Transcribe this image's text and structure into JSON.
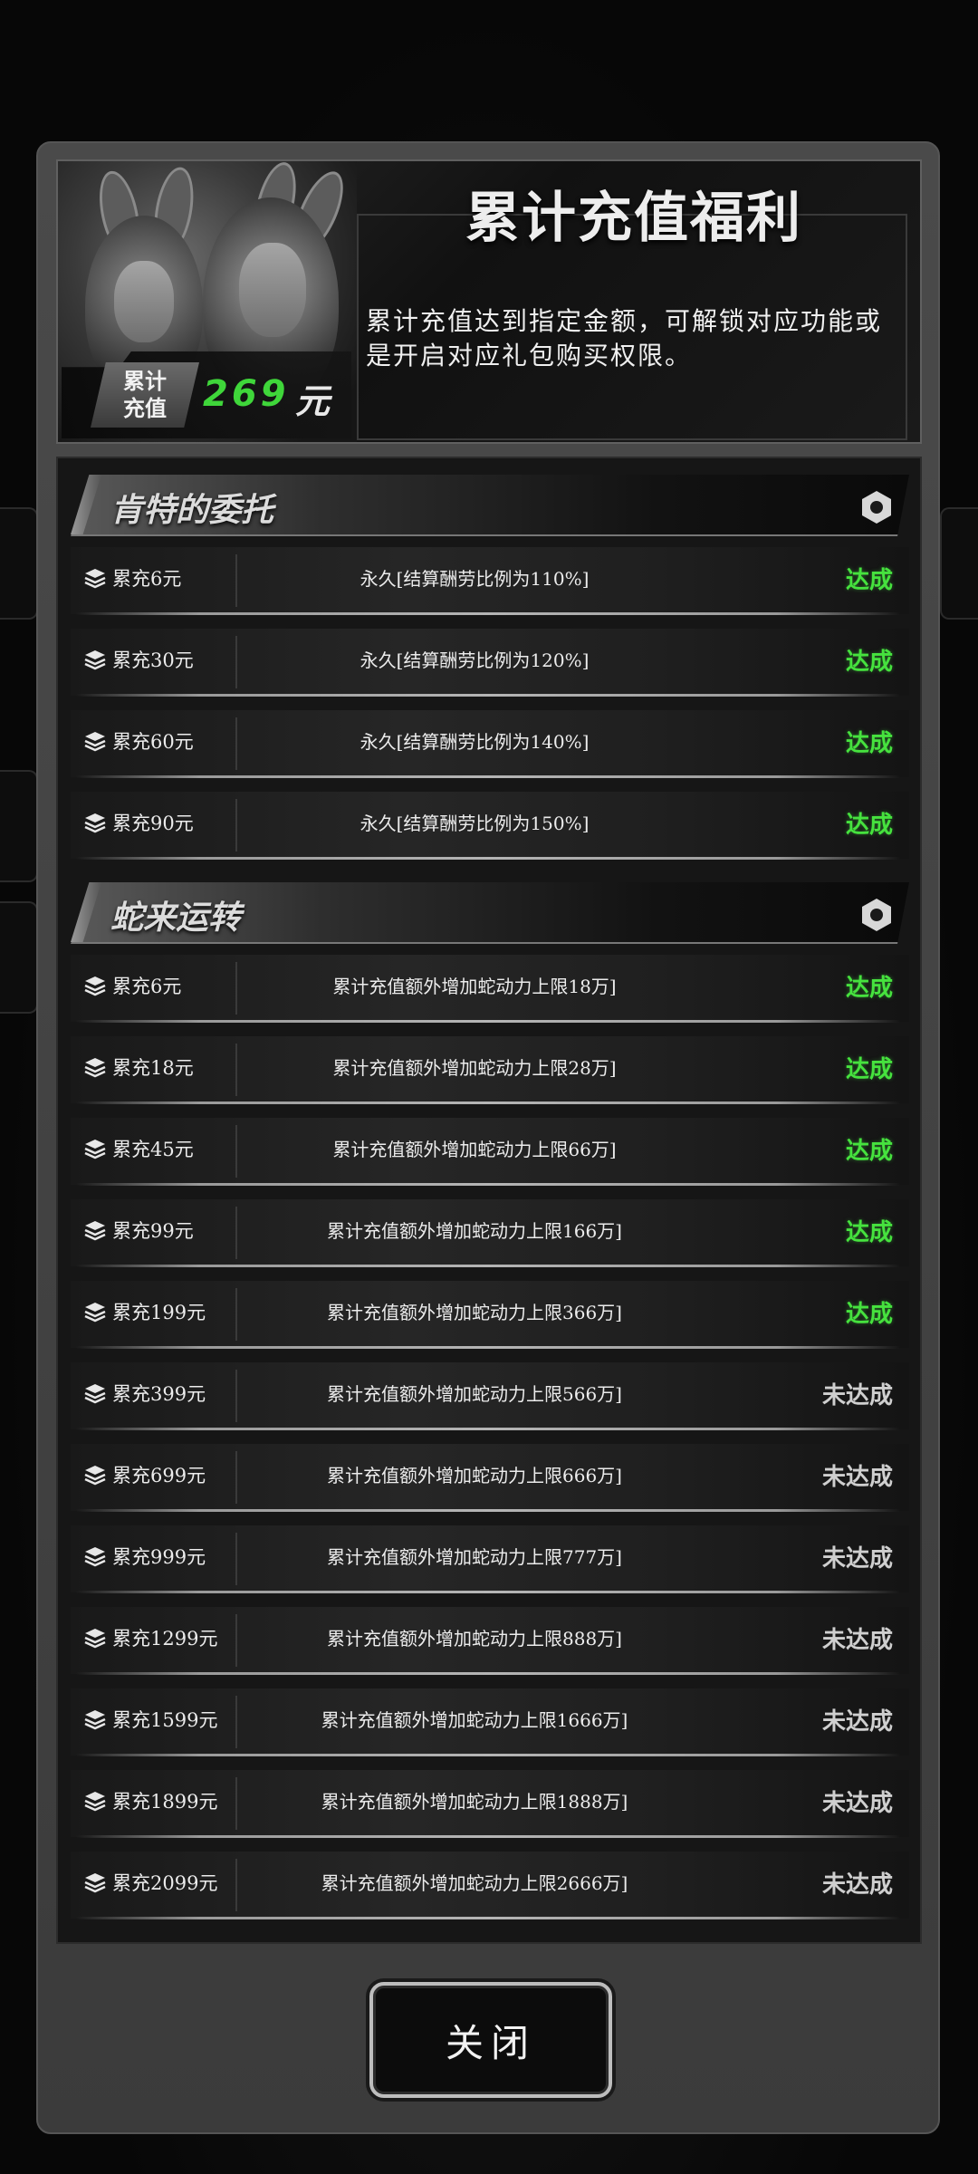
{
  "header": {
    "title": "累计充值福利",
    "description": "累计充值达到指定金额，可解锁对应功能或是开启对应礼包购买权限。",
    "badge_label_line1": "累计",
    "badge_label_line2": "充值",
    "total_value": "269",
    "total_unit": "元"
  },
  "sections": [
    {
      "title": "肯特的委托",
      "icon": "hexagon-icon",
      "rows": [
        {
          "amount": "累充6元",
          "desc": "永久[结算酬劳比例为110%]",
          "status": "达成"
        },
        {
          "amount": "累充30元",
          "desc": "永久[结算酬劳比例为120%]",
          "status": "达成"
        },
        {
          "amount": "累充60元",
          "desc": "永久[结算酬劳比例为140%]",
          "status": "达成"
        },
        {
          "amount": "累充90元",
          "desc": "永久[结算酬劳比例为150%]",
          "status": "达成"
        }
      ]
    },
    {
      "title": "蛇来运转",
      "icon": "hexagon-icon",
      "rows": [
        {
          "amount": "累充6元",
          "desc": "累计充值额外增加蛇动力上限18万]",
          "status": "达成"
        },
        {
          "amount": "累充18元",
          "desc": "累计充值额外增加蛇动力上限28万]",
          "status": "达成"
        },
        {
          "amount": "累充45元",
          "desc": "累计充值额外增加蛇动力上限66万]",
          "status": "达成"
        },
        {
          "amount": "累充99元",
          "desc": "累计充值额外增加蛇动力上限166万]",
          "status": "达成"
        },
        {
          "amount": "累充199元",
          "desc": "累计充值额外增加蛇动力上限366万]",
          "status": "达成"
        },
        {
          "amount": "累充399元",
          "desc": "累计充值额外增加蛇动力上限566万]",
          "status": "未达成"
        },
        {
          "amount": "累充699元",
          "desc": "累计充值额外增加蛇动力上限666万]",
          "status": "未达成"
        },
        {
          "amount": "累充999元",
          "desc": "累计充值额外增加蛇动力上限777万]",
          "status": "未达成"
        },
        {
          "amount": "累充1299元",
          "desc": "累计充值额外增加蛇动力上限888万]",
          "status": "未达成"
        },
        {
          "amount": "累充1599元",
          "desc": "累计充值额外增加蛇动力上限1666万]",
          "status": "未达成"
        },
        {
          "amount": "累充1899元",
          "desc": "累计充值额外增加蛇动力上限1888万]",
          "status": "未达成"
        },
        {
          "amount": "累充2099元",
          "desc": "累计充值额外增加蛇动力上限2666万]",
          "status": "未达成"
        }
      ]
    }
  ],
  "close_button": {
    "label": "关闭"
  },
  "colors": {
    "achieved": "#46e23e",
    "not_achieved": "#cfcfcf",
    "total_value": "#3fd63a"
  }
}
